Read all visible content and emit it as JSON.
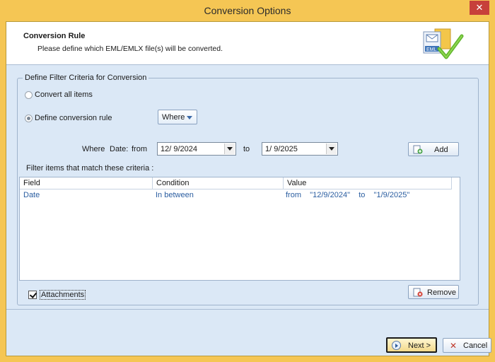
{
  "window": {
    "title": "Conversion Options",
    "close_glyph": "✕"
  },
  "header": {
    "title": "Conversion Rule",
    "subtitle": "Please define which EML/EMLX file(s) will be converted.",
    "logo_text": "EML",
    "logo_icon": "eml-check-icon"
  },
  "filter": {
    "group_label": "Define Filter Criteria for Conversion",
    "option_all": "Convert all items",
    "option_rule": "Define conversion rule",
    "selected_option": "rule",
    "rule_dropdown": "Where",
    "where_label": "Where",
    "date_label": "Date:",
    "from_label": "from",
    "from_value": "12/ 9/2024",
    "to_label": "to",
    "to_value": "1/ 9/2025",
    "add_label": "Add",
    "criteria_label": "Filter items that match these criteria :"
  },
  "grid": {
    "columns": [
      "Field",
      "Condition",
      "Value"
    ],
    "rows": [
      {
        "field": "Date",
        "condition": "In between",
        "value": "from    \"12/9/2024\"    to    \"1/9/2025\""
      }
    ]
  },
  "attachments": {
    "label": "Attachments",
    "checked": true
  },
  "remove_label": "Remove",
  "footer": {
    "next_label": "Next >",
    "cancel_label": "Cancel"
  },
  "colors": {
    "title_bar": "#f5c654",
    "client_bg": "#dbe8f6",
    "close_red": "#c7403a",
    "link_blue": "#2a5da0"
  }
}
